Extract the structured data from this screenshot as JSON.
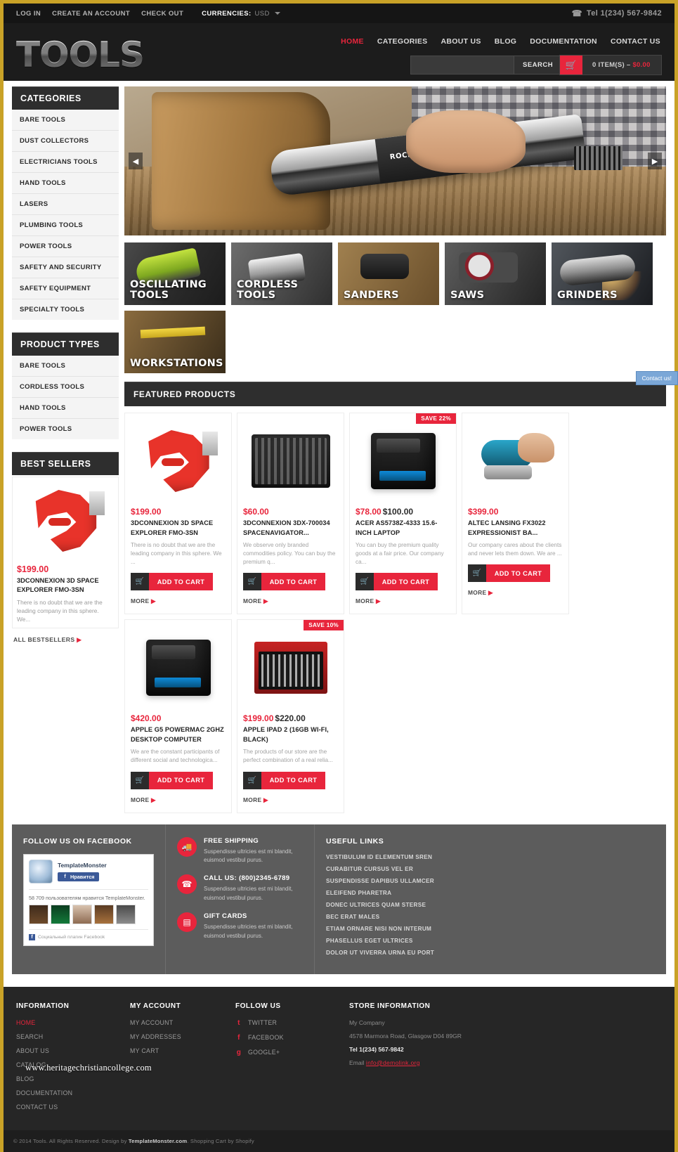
{
  "topbar": {
    "links": [
      "LOG IN",
      "CREATE AN ACCOUNT",
      "CHECK OUT"
    ],
    "currencies_label": "CURRENCIES:",
    "currency_value": "USD",
    "phone": "Tel 1(234) 567-9842"
  },
  "header": {
    "logo": "TOOLS",
    "nav": [
      "HOME",
      "CATEGORIES",
      "ABOUT US",
      "BLOG",
      "DOCUMENTATION",
      "CONTACT US"
    ],
    "active_nav": "HOME",
    "search_placeholder": "",
    "search_value": "",
    "search_button": "SEARCH",
    "cart_items": "0 ITEM(S) – ",
    "cart_total": "$0.00"
  },
  "sidebar": {
    "categories_title": "CATEGORIES",
    "categories": [
      "BARE TOOLS",
      "DUST COLLECTORS",
      "ELECTRICIANS TOOLS",
      "HAND TOOLS",
      "LASERS",
      "PLUMBING TOOLS",
      "POWER TOOLS",
      "SAFETY AND SECURITY",
      "SAFETY EQUIPMENT",
      "SPECIALTY TOOLS"
    ],
    "product_types_title": "PRODUCT TYPES",
    "product_types": [
      "BARE TOOLS",
      "CORDLESS TOOLS",
      "HAND TOOLS",
      "POWER TOOLS"
    ],
    "best_sellers_title": "BEST SELLERS",
    "best_seller": {
      "price": "$199.00",
      "title": "3DCONNEXION 3D SPACE EXPLORER FMO-3SN",
      "desc": "There is no doubt that we are the leading company in this sphere. We..."
    },
    "all_bestsellers": "ALL BESTSELLERS"
  },
  "tiles": [
    {
      "label_line1": "OSCILLATING",
      "label_line2": "TOOLS",
      "art": "t-osc"
    },
    {
      "label_line1": "CORDLESS",
      "label_line2": "TOOLS",
      "art": "t-cord"
    },
    {
      "label_line1": "SANDERS",
      "label_line2": "",
      "art": "t-sand"
    },
    {
      "label_line1": "SAWS",
      "label_line2": "",
      "art": "t-saws"
    },
    {
      "label_line1": "GRINDERS",
      "label_line2": "",
      "art": "t-grnd"
    },
    {
      "label_line1": "WORKSTATIONS",
      "label_line2": "",
      "art": "t-work"
    }
  ],
  "slider": {
    "brand_label": "ROCKWELL"
  },
  "featured": {
    "title": "FEATURED PRODUCTS",
    "add_to_cart": "ADD TO CART",
    "more": "MORE",
    "products": [
      {
        "price": "$199.00",
        "old_price": "",
        "badge": "",
        "title": "3DCONNEXION 3D SPACE EXPLORER FMO-3SN",
        "desc": "There is no doubt that we are the leading company in this sphere. We ...",
        "art": "art-clamp"
      },
      {
        "price": "$60.00",
        "old_price": "",
        "badge": "",
        "title": "3DCONNEXION 3DX-700034 SPACENAVIGATOR...",
        "desc": "We observe only branded commodities policy. You can buy the premium q...",
        "art": "art-case"
      },
      {
        "price": "$78.00",
        "old_price": "$100.00",
        "badge": "SAVE 22%",
        "title": "ACER AS5738Z-4333 15.6-INCH LAPTOP",
        "desc": "You can buy the premium quality goods at a fair price. Our company ca...",
        "art": "art-battery"
      },
      {
        "price": "$399.00",
        "old_price": "",
        "badge": "",
        "title": "ALTEC LANSING FX3022 EXPRESSIONIST BA...",
        "desc": "Our company cares about the clients and never lets them down. We are ...",
        "art": "art-sander"
      },
      {
        "price": "$420.00",
        "old_price": "",
        "badge": "",
        "title": "APPLE G5 POWERMAC 2GHZ DESKTOP COMPUTER",
        "desc": "We are the constant participants of different social and technologica...",
        "art": "art-battery"
      },
      {
        "price": "$199.00",
        "old_price": "$220.00",
        "badge": "SAVE 10%",
        "title": "APPLE IPAD 2 (16GB WI-FI, BLACK)",
        "desc": "The products of our store are the perfect combination of a real relia...",
        "art": "art-kit"
      }
    ]
  },
  "infoband": {
    "facebook_title": "FOLLOW US ON FACEBOOK",
    "fb_page_name": "TemplateMonster",
    "fb_like_label": "Нравится",
    "fb_count": "58 709 пользователям нравится TemplateMonster.",
    "fb_footer": "Социальный плагин Facebook",
    "services": [
      {
        "icon": "truck-icon",
        "title": "FREE SHIPPING",
        "desc": "Suspendisse ultricies est mi blandit, euismod vestibul purus."
      },
      {
        "icon": "phone-icon",
        "title": "CALL US: (800)2345-6789",
        "desc": "Suspendisse ultricies est mi blandit, euismod vestibul purus."
      },
      {
        "icon": "card-icon",
        "title": "GIFT CARDS",
        "desc": "Suspendisse ultricies est mi blandit, euismod vestibul purus."
      }
    ],
    "useful_links_title": "USEFUL LINKS",
    "useful_links": [
      "VESTIBULUM ID ELEMENTUM SREN",
      "CURABITUR CURSUS VEL ER",
      "SUSPENDISSE DAPIBUS ULLAMCER",
      "ELEIFEND PHARETRA",
      "DONEC ULTRICES QUAM STERSE",
      "BEC ERAT MALES",
      "ETIAM ORNARE NISI NON INTERUM",
      "PHASELLUS EGET ULTRICES",
      "DOLOR UT VIVERRA URNA EU PORT"
    ]
  },
  "footer": {
    "information_title": "INFORMATION",
    "information": [
      "HOME",
      "SEARCH",
      "ABOUT US",
      "CATALOG",
      "BLOG",
      "DOCUMENTATION",
      "CONTACT US"
    ],
    "information_active": "HOME",
    "account_title": "MY ACCOUNT",
    "account": [
      "MY ACCOUNT",
      "MY ADDRESSES",
      "MY CART"
    ],
    "follow_title": "FOLLOW US",
    "follow": [
      {
        "icon": "twitter-icon",
        "glyph": "t",
        "label": "TWITTER"
      },
      {
        "icon": "facebook-icon",
        "glyph": "f",
        "label": "FACEBOOK"
      },
      {
        "icon": "google-plus-icon",
        "glyph": "g",
        "label": "GOOGLE+"
      }
    ],
    "store_title": "STORE INFORMATION",
    "store_company": "My Company",
    "store_address": "4578 Marmora Road, Glasgow D04 89GR",
    "store_phone": "Tel 1(234) 567-9842",
    "store_email_label": "Email ",
    "store_email": "info@demolink.org",
    "copyright_pre": "© 2014 Tools. All Rights Reserved. Design by ",
    "copyright_brand": "TemplateMonster.com",
    "copyright_post": ". Shopping Cart by Shopify"
  },
  "overlays": {
    "contact_tab": "Contact us!",
    "watermark": "www.heritagechristiancollege.com"
  },
  "colors": {
    "accent": "#e8253c",
    "dark": "#1c1c1c",
    "panel": "#2e2e2e",
    "band": "#5c5c5c",
    "page_border": "#c9a227"
  }
}
